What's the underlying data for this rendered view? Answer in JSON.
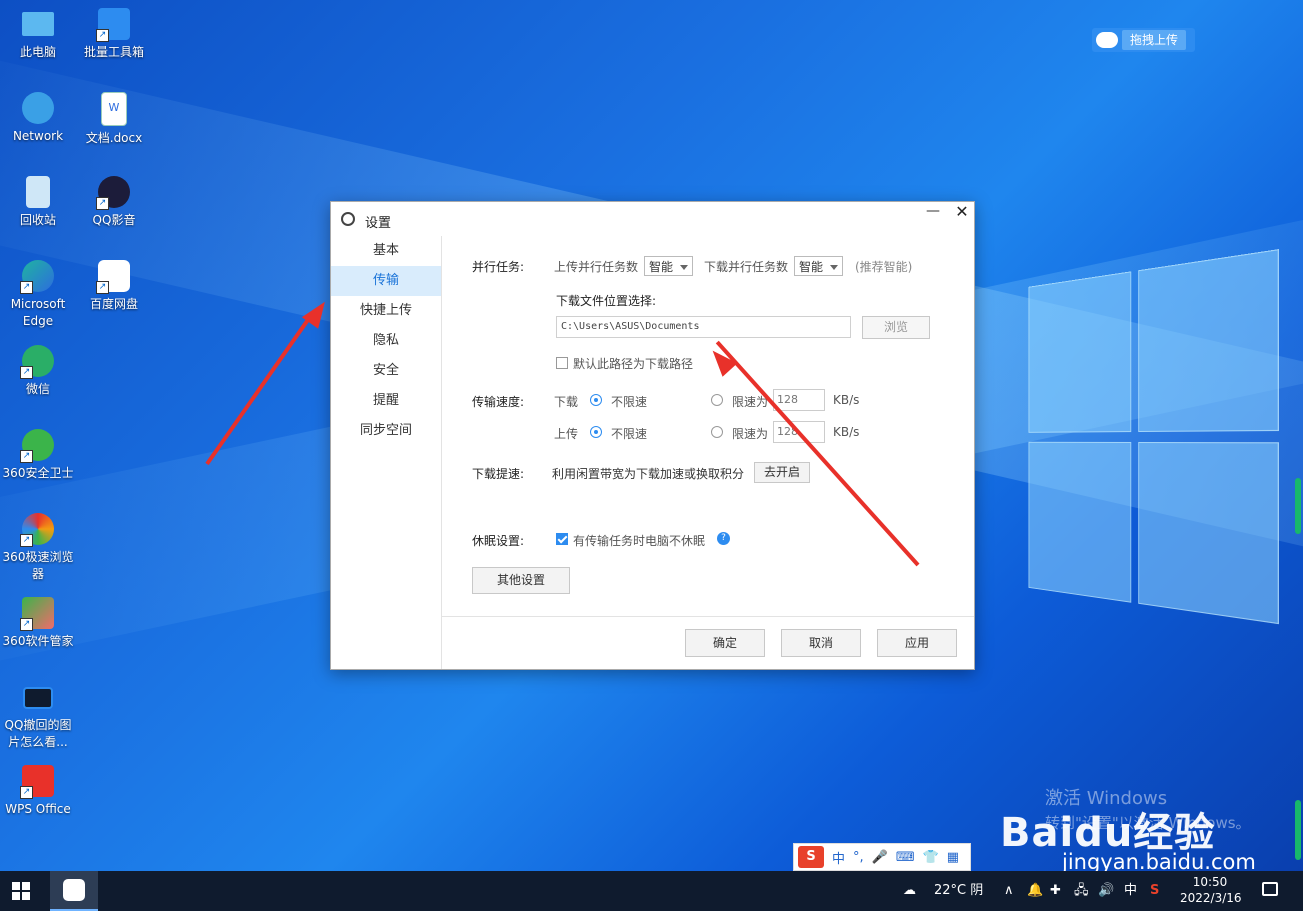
{
  "desktop": {
    "icons": [
      {
        "label": "此电脑",
        "color": "#3aa0e6"
      },
      {
        "label": "批量工具箱",
        "color": "#2d8cf0"
      },
      {
        "label": "Network",
        "color": "#3aa0e6"
      },
      {
        "label": "文档.docx",
        "color": "#ffffff"
      },
      {
        "label": "回收站",
        "color": "#cfe7f7"
      },
      {
        "label": "QQ影音",
        "color": "#1c1c3a"
      },
      {
        "label": "Microsoft Edge",
        "color": "#1fb4a0"
      },
      {
        "label": "百度网盘",
        "color": "#ffffff"
      },
      {
        "label": "微信",
        "color": "#2aae67"
      },
      {
        "label": "360安全卫士",
        "color": "#3bb44a"
      },
      {
        "label": "360极速浏览器",
        "color": "#f39c12"
      },
      {
        "label": "360软件管家",
        "color": "#3bb44a"
      },
      {
        "label": "QQ撤回的图片怎么看...",
        "color": "#2d8cf0"
      },
      {
        "label": "WPS Office",
        "color": "#e8312a"
      }
    ],
    "drag_upload_label": "拖拽上传",
    "watermark_line1": "激活 Windows",
    "watermark_line2": "转到\"设置\"以激活 Windows。",
    "baidu_logo": "Baidu经验",
    "baidu_url": "jingyan.baidu.com"
  },
  "dialog": {
    "title": "设置",
    "minimize_icon": "minimize-icon",
    "close_icon": "close-icon",
    "nav": [
      "基本",
      "传输",
      "快捷上传",
      "隐私",
      "安全",
      "提醒",
      "同步空间"
    ],
    "active_nav": "传输",
    "parallel": {
      "section_label": "并行任务:",
      "upload_label": "上传并行任务数",
      "upload_value": "智能",
      "download_label": "下载并行任务数",
      "download_value": "智能",
      "hint": "(推荐智能)"
    },
    "download_location": {
      "label": "下载文件位置选择:",
      "path": "C:\\Users\\ASUS\\Documents",
      "browse_label": "浏览",
      "default_path_label": "默认此路径为下载路径",
      "default_path_checked": false
    },
    "speed": {
      "section_label": "传输速度:",
      "download_label": "下载",
      "upload_label": "上传",
      "unlimited_label": "不限速",
      "limit_label": "限速为",
      "download_limit_value": "128",
      "upload_limit_value": "128",
      "unit": "KB/s",
      "download_mode": "unlimited",
      "upload_mode": "unlimited"
    },
    "boost": {
      "section_label": "下载提速:",
      "desc": "利用闲置带宽为下载加速或换取积分",
      "button_label": "去开启"
    },
    "sleep": {
      "section_label": "休眠设置:",
      "checkbox_label": "有传输任务时电脑不休眠",
      "checked": true
    },
    "other_settings_label": "其他设置",
    "buttons": {
      "ok": "确定",
      "cancel": "取消",
      "apply": "应用"
    }
  },
  "ime": {
    "logo": "S",
    "mode": "中",
    "punct": "°,"
  },
  "taskbar": {
    "weather": "22°C 阴",
    "ime": "中",
    "time": "10:50",
    "date": "2022/3/16"
  },
  "colors": {
    "accent": "#2d8cf0",
    "arrow": "#e8312a",
    "nav_active_bg": "#d9ecfc"
  }
}
